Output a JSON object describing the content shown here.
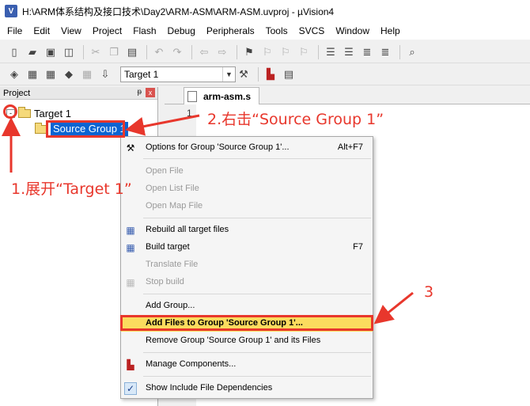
{
  "window": {
    "title": "H:\\ARM体系结构及接口技术\\Day2\\ARM-ASM\\ARM-ASM.uvproj - µVision4",
    "app_icon": "uvision-icon"
  },
  "menu": [
    "File",
    "Edit",
    "View",
    "Project",
    "Flash",
    "Debug",
    "Peripherals",
    "Tools",
    "SVCS",
    "Window",
    "Help"
  ],
  "toolbar": {
    "target_select": "Target 1"
  },
  "project_panel": {
    "title": "Project",
    "pin": "ᵽ",
    "close": "x",
    "tree": {
      "target_label": "Target 1",
      "expander": "-",
      "group_label": "Source Group 1"
    }
  },
  "editor": {
    "tab_label": "arm-asm.s",
    "line_number": "1"
  },
  "context_menu": {
    "items": [
      {
        "label": "Options for Group 'Source Group 1'...",
        "shortcut": "Alt+F7",
        "enabled": true,
        "icon": "magic-wand-icon"
      },
      {
        "label": "Open File",
        "shortcut": "",
        "enabled": false,
        "icon": ""
      },
      {
        "label": "Open List File",
        "shortcut": "",
        "enabled": false,
        "icon": ""
      },
      {
        "label": "Open Map File",
        "shortcut": "",
        "enabled": false,
        "icon": ""
      },
      {
        "label": "Rebuild all target files",
        "shortcut": "",
        "enabled": true,
        "icon": "rebuild-icon"
      },
      {
        "label": "Build target",
        "shortcut": "F7",
        "enabled": true,
        "icon": "build-icon"
      },
      {
        "label": "Translate File",
        "shortcut": "",
        "enabled": false,
        "icon": ""
      },
      {
        "label": "Stop build",
        "shortcut": "",
        "enabled": false,
        "icon": "stop-build-icon"
      },
      {
        "label": "Add Group...",
        "shortcut": "",
        "enabled": true,
        "icon": ""
      },
      {
        "label": "Add Files to Group 'Source Group 1'...",
        "shortcut": "",
        "enabled": true,
        "icon": "",
        "highlighted": true
      },
      {
        "label": "Remove Group 'Source Group 1' and its Files",
        "shortcut": "",
        "enabled": true,
        "icon": ""
      },
      {
        "label": "Manage Components...",
        "shortcut": "",
        "enabled": true,
        "icon": "components-icon"
      },
      {
        "label": "Show Include File Dependencies",
        "shortcut": "",
        "enabled": true,
        "icon": "checkmark-icon",
        "checked": true
      }
    ],
    "check_mark": "✓"
  },
  "annotations": {
    "step1": "1.展开“Target 1”",
    "step2": "2.右击“Source Group 1”",
    "step3": "3"
  },
  "colors": {
    "annotation_red": "#e8372c",
    "selection_blue": "#0a64d2",
    "menu_highlight": "#fbdc5e"
  }
}
